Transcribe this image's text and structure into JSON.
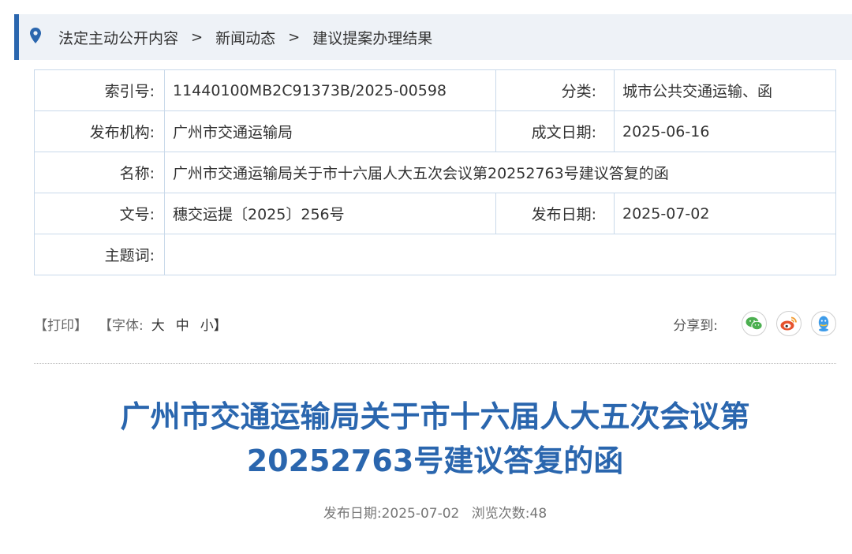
{
  "breadcrumb": {
    "items": [
      "法定主动公开内容",
      "新闻动态",
      "建议提案办理结果"
    ],
    "separator": ">"
  },
  "meta": {
    "index_label": "索引号:",
    "index_value": "11440100MB2C91373B/2025-00598",
    "category_label": "分类:",
    "category_value": "城市公共交通运输、函",
    "publisher_label": "发布机构:",
    "publisher_value": "广州市交通运输局",
    "written_date_label": "成文日期:",
    "written_date_value": "2025-06-16",
    "name_label": "名称:",
    "name_value": "广州市交通运输局关于市十六届人大五次会议第20252763号建议答复的函",
    "doc_no_label": "文号:",
    "doc_no_value": "穗交运提〔2025〕256号",
    "publish_date_label": "发布日期:",
    "publish_date_value": "2025-07-02",
    "keywords_label": "主题词:",
    "keywords_value": ""
  },
  "tools": {
    "print": "【打印】",
    "font_prefix": "【字体:",
    "font_large": "大",
    "font_medium": "中",
    "font_small": "小】",
    "share_label": "分享到:"
  },
  "colors": {
    "accent": "#2a66ae",
    "wechat": "#4caf50",
    "weibo": "#e6522c",
    "qq": "#3d9be9"
  },
  "article": {
    "title_line1": "广州市交通运输局关于市十六届人大五次会议第",
    "title_line2": "20252763号建议答复的函",
    "publish_info": "发布日期:2025-07-02",
    "views_info": "浏览次数:48"
  }
}
